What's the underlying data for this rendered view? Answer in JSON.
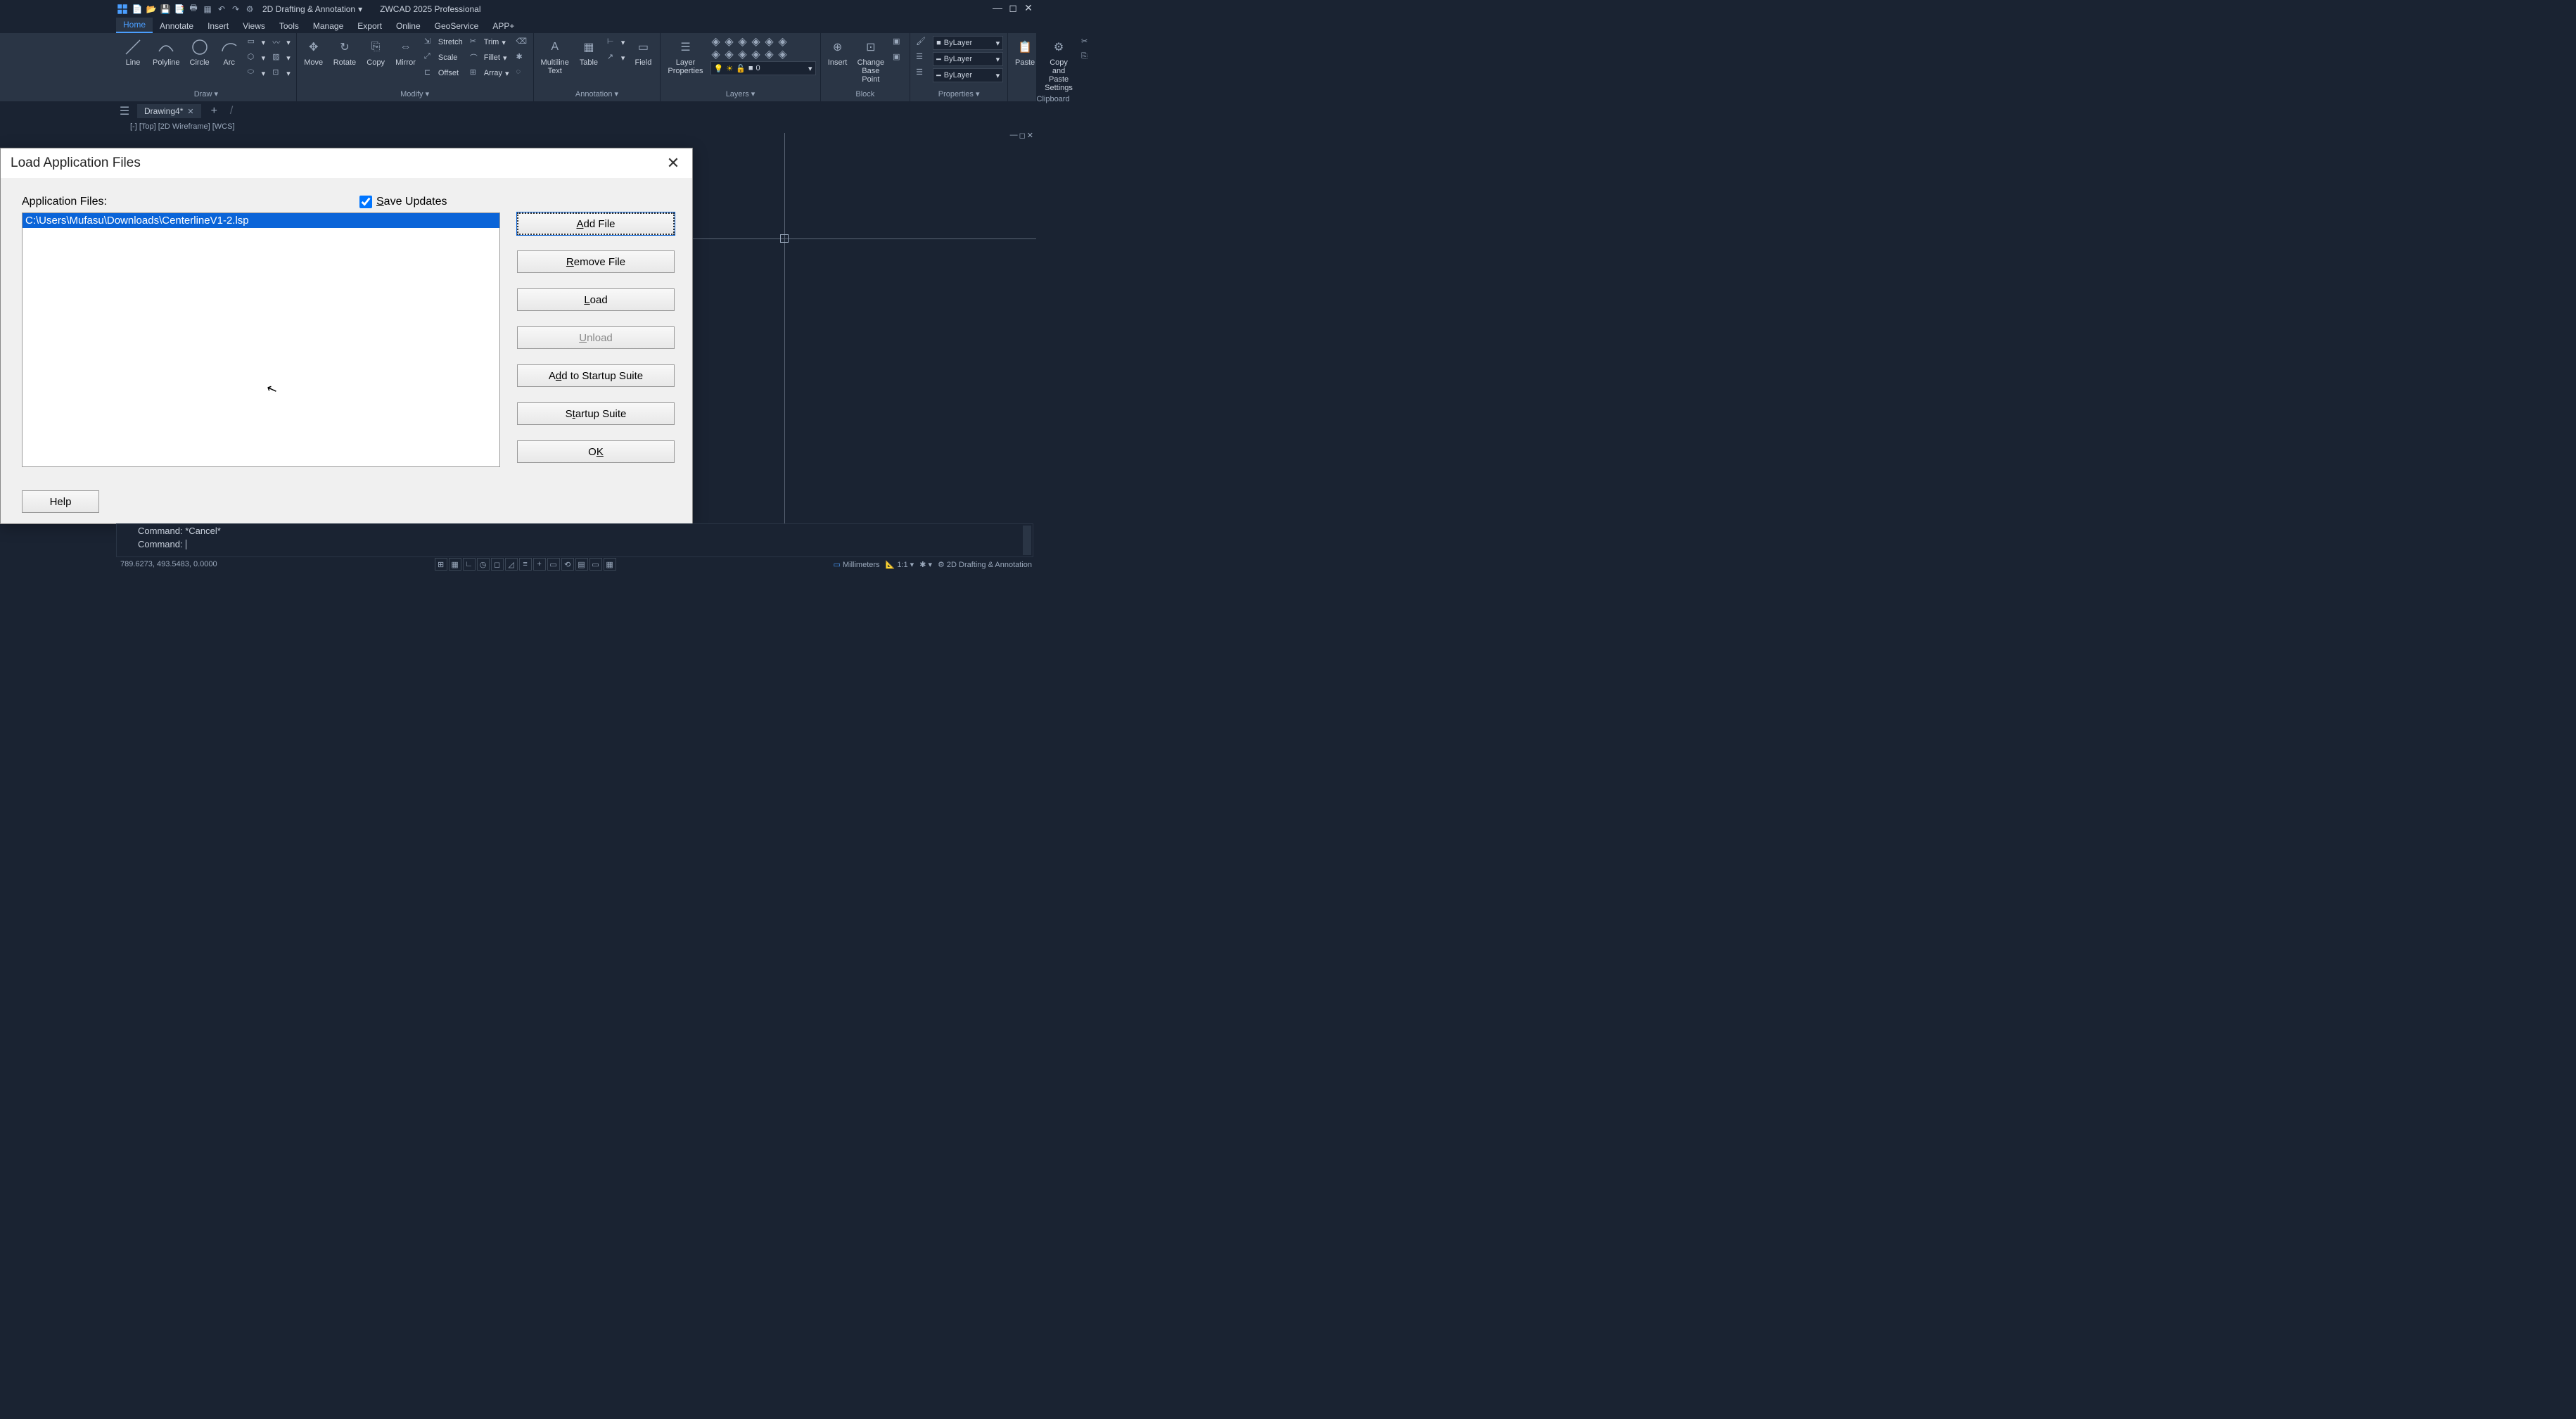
{
  "title_bar": {
    "workspace": "2D Drafting & Annotation",
    "app_title": "ZWCAD 2025 Professional"
  },
  "menu": {
    "items": [
      "Home",
      "Annotate",
      "Insert",
      "Views",
      "Tools",
      "Manage",
      "Export",
      "Online",
      "GeoService",
      "APP+"
    ],
    "active_index": 0
  },
  "ribbon": {
    "draw": {
      "title": "Draw",
      "line": "Line",
      "polyline": "Polyline",
      "circle": "Circle",
      "arc": "Arc"
    },
    "modify": {
      "title": "Modify",
      "move": "Move",
      "rotate": "Rotate",
      "copy": "Copy",
      "mirror": "Mirror",
      "stretch": "Stretch",
      "scale": "Scale",
      "offset": "Offset",
      "trim": "Trim",
      "fillet": "Fillet",
      "array": "Array"
    },
    "annotation": {
      "title": "Annotation",
      "mtext": "Multiline\nText",
      "table": "Table",
      "field": "Field"
    },
    "layers": {
      "title": "Layers",
      "properties": "Layer\nProperties",
      "current": "0"
    },
    "block": {
      "title": "Block",
      "insert": "Insert",
      "change_bp": "Change\nBase Point"
    },
    "properties": {
      "title": "Properties",
      "bylayer1": "ByLayer",
      "bylayer2": "ByLayer",
      "bylayer3": "ByLayer"
    },
    "clipboard": {
      "title": "Clipboard",
      "paste": "Paste",
      "copy_paste": "Copy and Paste\nSettings"
    }
  },
  "doc_tabs": {
    "drawing": "Drawing4*"
  },
  "viewport": {
    "label": "[-] [Top] [2D Wireframe] [WCS]"
  },
  "dialog": {
    "title": "Load Application Files",
    "app_files_label": "Application Files:",
    "save_updates": "Save Updates",
    "save_updates_hint": "S",
    "selected_file": "C:\\Users\\Mufasu\\Downloads\\CenterlineV1-2.lsp",
    "buttons": {
      "add_file": "Add File",
      "remove_file": "Remove File",
      "load": "Load",
      "unload": "Unload",
      "add_startup": "Add to Startup Suite",
      "startup_suite": "Startup Suite",
      "ok": "OK",
      "help": "Help"
    }
  },
  "command": {
    "history": "Command: *Cancel*",
    "prompt": "Command:"
  },
  "status": {
    "coords": "789.6273, 493.5483, 0.0000",
    "units": "Millimeters",
    "scale": "1:1",
    "workspace": "2D Drafting & Annotation"
  }
}
